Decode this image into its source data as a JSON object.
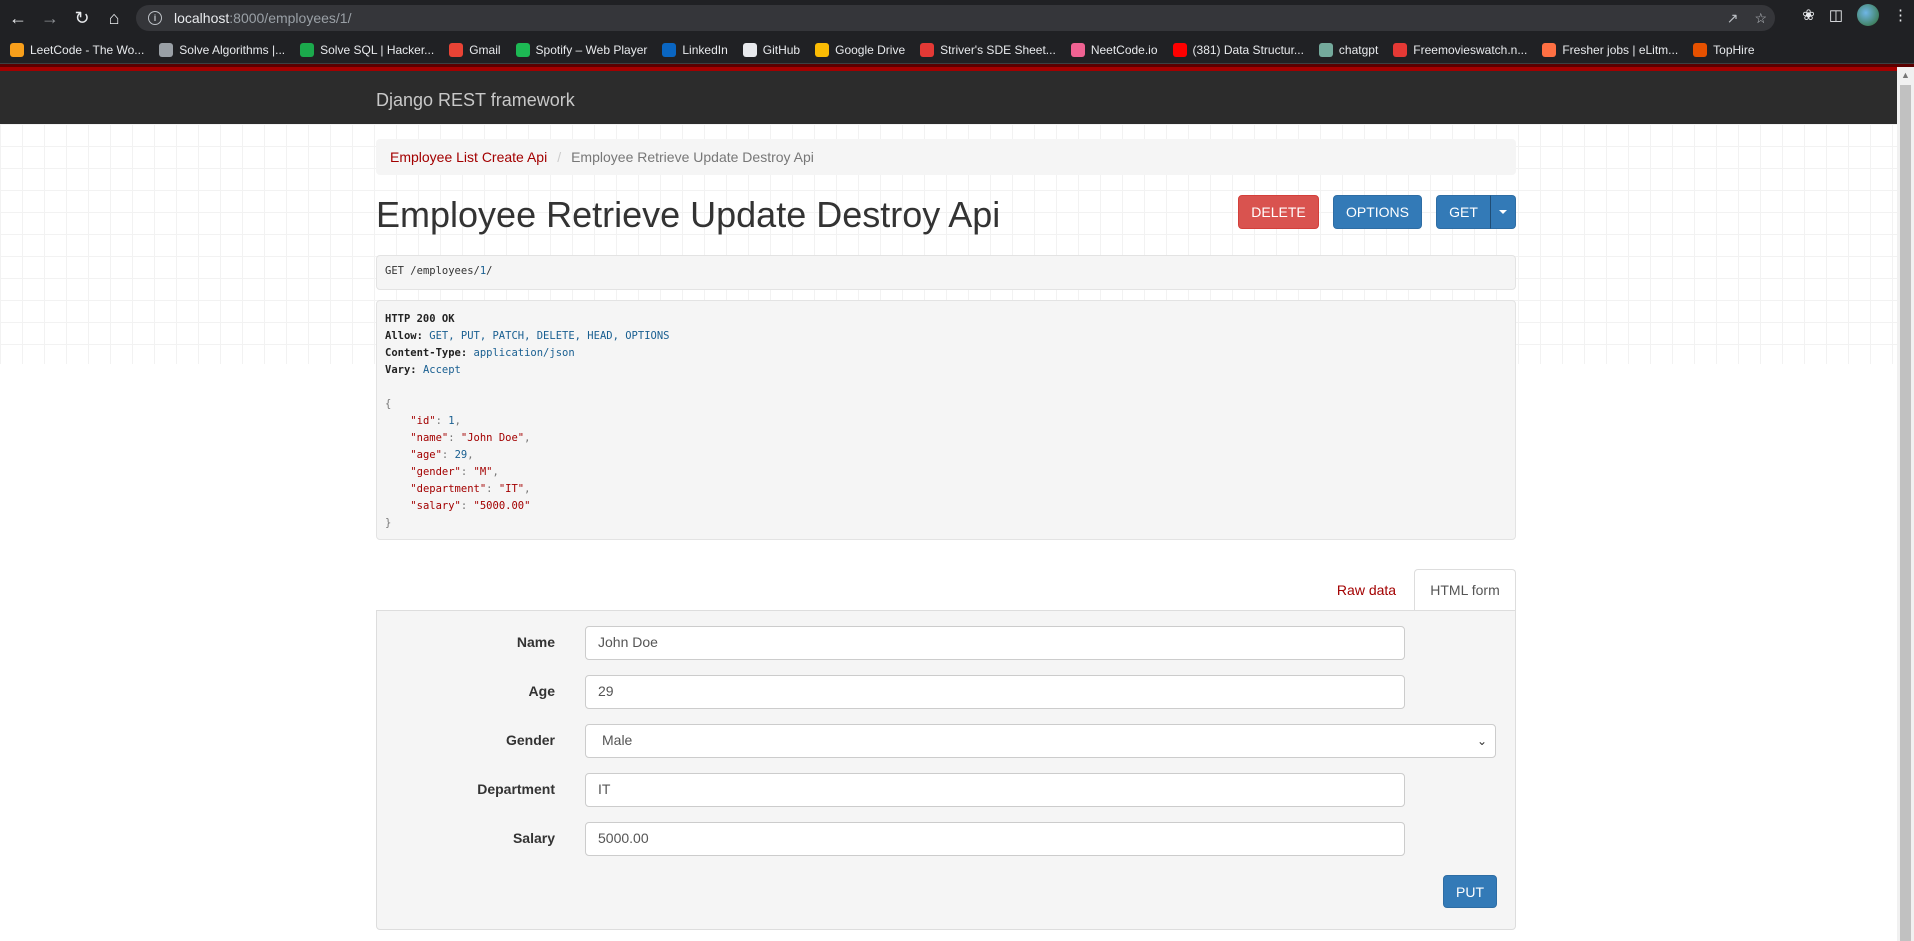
{
  "browser": {
    "url_host": "localhost",
    "url_rest": ":8000/employees/1/",
    "bookmarks": [
      {
        "label": "LeetCode - The Wo...",
        "color": "#f89f1b"
      },
      {
        "label": "Solve Algorithms |...",
        "color": "#9aa0a6"
      },
      {
        "label": "Solve SQL | Hacker...",
        "color": "#1ba94c"
      },
      {
        "label": "Gmail",
        "color": "#ea4335"
      },
      {
        "label": "Spotify – Web Player",
        "color": "#1db954"
      },
      {
        "label": "LinkedIn",
        "color": "#0a66c2"
      },
      {
        "label": "GitHub",
        "color": "#e8eaed"
      },
      {
        "label": "Google Drive",
        "color": "#fbbc04"
      },
      {
        "label": "Striver's SDE Sheet...",
        "color": "#e53935"
      },
      {
        "label": "NeetCode.io",
        "color": "#f06292"
      },
      {
        "label": "(381) Data Structur...",
        "color": "#ff0000"
      },
      {
        "label": "chatgpt",
        "color": "#74aa9c"
      },
      {
        "label": "Freemovieswatch.n...",
        "color": "#e53935"
      },
      {
        "label": "Fresher jobs | eLitm...",
        "color": "#ff7043"
      },
      {
        "label": "TopHire",
        "color": "#e65100"
      }
    ]
  },
  "drf": {
    "brand": "Django REST framework"
  },
  "breadcrumb": {
    "link": "Employee List Create Api",
    "separator": "/",
    "active": "Employee Retrieve Update Destroy Api"
  },
  "header": {
    "title": "Employee Retrieve Update Destroy Api",
    "delete_label": "DELETE",
    "options_label": "OPTIONS",
    "get_label": "GET"
  },
  "request": {
    "method": "GET",
    "path_prefix": "/employees/",
    "path_id": "1",
    "path_suffix": "/"
  },
  "response": {
    "status": "HTTP 200 OK",
    "allow_name": "Allow:",
    "allow_value": "GET, PUT, PATCH, DELETE, HEAD, OPTIONS",
    "content_type_name": "Content-Type:",
    "content_type_value": "application/json",
    "vary_name": "Vary:",
    "vary_value": "Accept",
    "open_brace": "{",
    "close_brace": "}",
    "fields": [
      {
        "key": "\"id\"",
        "value": "1",
        "type": "num"
      },
      {
        "key": "\"name\"",
        "value": "\"John Doe\"",
        "type": "str"
      },
      {
        "key": "\"age\"",
        "value": "29",
        "type": "num"
      },
      {
        "key": "\"gender\"",
        "value": "\"M\"",
        "type": "str"
      },
      {
        "key": "\"department\"",
        "value": "\"IT\"",
        "type": "str"
      },
      {
        "key": "\"salary\"",
        "value": "\"5000.00\"",
        "type": "str"
      }
    ]
  },
  "tabs": {
    "raw": "Raw data",
    "html": "HTML form"
  },
  "form": {
    "name_label": "Name",
    "name_value": "John Doe",
    "age_label": "Age",
    "age_value": "29",
    "gender_label": "Gender",
    "gender_value": "Male",
    "department_label": "Department",
    "department_value": "IT",
    "salary_label": "Salary",
    "salary_value": "5000.00",
    "put_label": "PUT"
  }
}
